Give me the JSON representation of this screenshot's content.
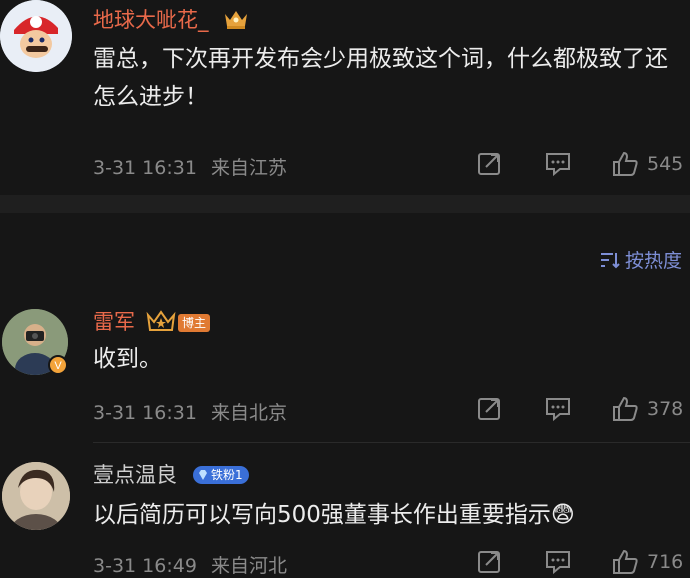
{
  "comments": [
    {
      "username": "地球大呲花_",
      "text": "雷总，下次再开发布会少用极致这个词，什么都极致了还怎么进步！",
      "date": "3-31 16:31",
      "location": "来自江苏",
      "likes": "545",
      "username_color": "#e8694a"
    },
    {
      "username": "雷军",
      "badge": "博主",
      "text": "收到。",
      "date": "3-31 16:31",
      "location": "来自北京",
      "likes": "378",
      "username_color": "#e8694a"
    },
    {
      "username": "壹点温良",
      "badge": "铁粉1",
      "text": "以后简历可以写向500强董事长作出重要指示😨",
      "date": "3-31 16:49",
      "location": "来自河北",
      "likes": "716",
      "username_color": "#cfcfcf"
    }
  ],
  "sort": {
    "label": "按热度"
  },
  "colors": {
    "accent": "#7e8fd6",
    "background": "#161616"
  }
}
